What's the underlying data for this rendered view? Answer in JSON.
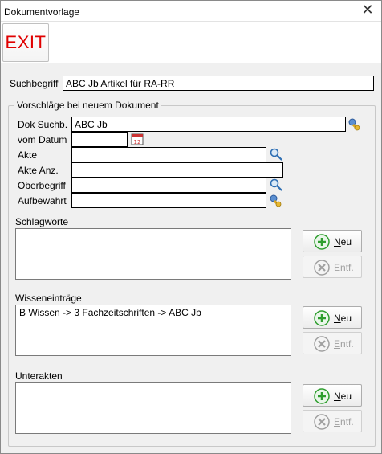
{
  "window": {
    "title": "Dokumentvorlage",
    "close_symbol": "✕"
  },
  "toolbar": {
    "exit_label": "EXIT"
  },
  "suchbegriff": {
    "label": "Suchbegriff",
    "value": "ABC Jb Artikel für RA-RR"
  },
  "group": {
    "legend": "Vorschläge bei neuem Dokument",
    "dok_suchb": {
      "label": "Dok Suchb.",
      "value": "ABC Jb"
    },
    "vom_datum": {
      "label": "vom Datum",
      "value": ""
    },
    "akte": {
      "label": "Akte",
      "value": ""
    },
    "akte_anz": {
      "label": "Akte Anz.",
      "value": ""
    },
    "oberbegriff": {
      "label": "Oberbegriff",
      "value": ""
    },
    "aufbewahrt": {
      "label": "Aufbewahrt",
      "value": ""
    },
    "schlagworte": {
      "label": "Schlagworte",
      "items": []
    },
    "wissen": {
      "label": "Wisseneinträge",
      "items": [
        "B Wissen -> 3 Fachzeitschriften -> ABC Jb"
      ]
    },
    "unterakten": {
      "label": "Unterakten",
      "items": []
    }
  },
  "buttons": {
    "neu_label": "Neu",
    "entf_label": "Entf.",
    "neu_underline": "N",
    "neu_rest": "eu",
    "entf_underline": "E",
    "entf_rest": "ntf."
  },
  "icons": {
    "exit": "exit-text",
    "close": "close-icon",
    "key": "key-icon",
    "calendar": "calendar-icon",
    "search": "magnifier-icon",
    "add": "add-icon",
    "remove": "remove-icon"
  },
  "colors": {
    "exit_red": "#e00000",
    "add_green": "#2e9e2e",
    "disabled_gray": "#a0a0a0"
  }
}
